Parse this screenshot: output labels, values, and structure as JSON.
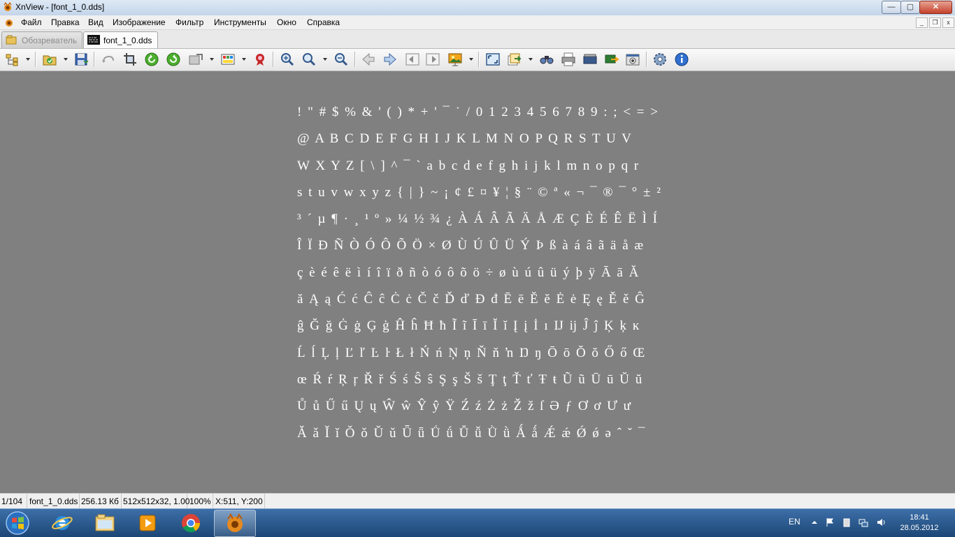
{
  "window": {
    "title": "XnView - [font_1_0.dds]"
  },
  "window_controls": {
    "minimize": "—",
    "maximize": "▢",
    "close": "✕"
  },
  "menu": {
    "items": [
      "Файл",
      "Правка",
      "Вид",
      "Изображение",
      "Фильтр",
      "Инструменты",
      "Окно",
      "Справка"
    ]
  },
  "mdi_controls": {
    "minimize": "_",
    "restore": "❐",
    "close": "x"
  },
  "tabs": [
    {
      "label": "Обозреватель",
      "active": false
    },
    {
      "label": "font_1_0.dds",
      "active": true
    }
  ],
  "toolbar": {
    "icons": [
      "browser-icon",
      "open-folder-icon",
      "save-icon",
      "undo-icon",
      "crop-icon",
      "rotate-left-icon",
      "rotate-right-icon",
      "transform-icon",
      "color-adjust-icon",
      "filter-icon",
      "zoom-in-icon",
      "zoom-icon",
      "zoom-out-icon",
      "previous-icon",
      "next-icon",
      "first-icon",
      "last-icon",
      "slideshow-icon",
      "fullscreen-icon",
      "export-icon",
      "find-icon",
      "print-icon",
      "scan-icon",
      "wallpaper-icon",
      "capture-icon",
      "settings-icon",
      "info-icon"
    ]
  },
  "glyph_rows": [
    "! \" # $ % & ' ( ) * + ' ¯ ˙ / 0 1 2 3 4 5 6 7 8 9 : ; < = > ?",
    "@ A B C D E F G H I J K L M N O P Q R S T U V",
    "W X Y Z [ \\ ] ^ ¯ ` a b c d e f g h i j k l m n o p q r",
    "s t u v w x y z { | } ~ ¡ ¢ £ ¤ ¥ ¦ § ¨ © ª « ¬ ¯ ® ¯ ° ± ²",
    "³ ´ µ ¶ · ¸ ¹ º » ¼ ½ ¾ ¿ À Á Â Ã Ä Å Æ Ç È É Ê Ë Ì Í",
    "Î Ï Ð Ñ Ò Ó Ô Õ Ö × Ø Ù Ú Û Ü Ý Þ ß à á â ã ä å æ",
    "ç è é ê ë ì í î ï ð ñ ò ó ô õ ö ÷ ø ù ú û ü ý þ ÿ Ā ā Ă",
    "ă Ą ą Ć ć Ĉ ĉ Ċ ċ Č č Ď ď Đ đ Ē ē Ĕ ĕ Ė ė Ę ę Ě ě Ĝ",
    "ĝ Ğ ğ Ġ ġ Ģ ģ Ĥ ĥ Ħ ħ Ĩ ĩ Ī ī Ĭ ĭ Į į İ ı Ĳ ĳ Ĵ ĵ Ķ ķ ĸ",
    "Ĺ ĺ Ļ ļ Ľ ľ Ŀ ŀ Ł ł Ń ń Ņ ņ Ň ň ŉ Ŋ ŋ Ō ō Ŏ ŏ Ő ő Œ",
    "œ Ŕ ŕ Ŗ ŗ Ř ř Ś ś Ŝ ŝ Ş ş Š š Ţ ţ Ť ť Ŧ ŧ Ũ ũ Ū ū Ŭ ŭ",
    "Ů ů Ű ű Ų ų Ŵ ŵ Ŷ ŷ Ÿ Ź ź Ż ż Ž ž ſ Ə ƒ Ơ ơ Ư ư",
    "Ǎ ǎ Ǐ ǐ Ǒ ǒ Ǔ ǔ Ǖ ǖ Ǘ ǘ Ǚ ǚ Ǜ ǜ Ǻ ǻ Ǽ ǽ Ǿ ǿ ə ˆ ˇ ¯"
  ],
  "status": {
    "index": "1/104",
    "filename": "font_1_0.dds",
    "size": "256.13 Кб",
    "dimensions": "512x512x32, 1.00",
    "zoom": "100%",
    "coords": "X:511, Y:200"
  },
  "taskbar": {
    "apps": [
      "start-button",
      "internet-explorer",
      "file-explorer",
      "media-player",
      "chrome",
      "xnview"
    ],
    "lang": "EN",
    "time": "18:41",
    "date": "28.05.2012"
  }
}
